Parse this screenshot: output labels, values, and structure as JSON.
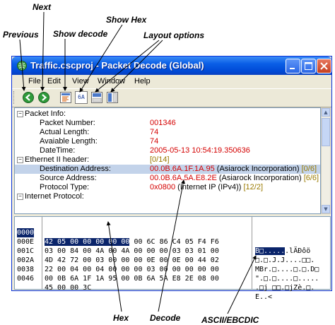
{
  "callouts": {
    "previous": "Previous",
    "next": "Next",
    "show_decode": "Show decode",
    "show_hex": "Show Hex",
    "layout_options": "Layout options",
    "hex": "Hex",
    "decode": "Decode",
    "ascii_ebcdic": "ASCII/EBCDIC"
  },
  "window": {
    "title": "Traffic.cscproj - Packet Decode (Global)",
    "icon": "app-globe-icon"
  },
  "menu": [
    "File",
    "Edit",
    "View",
    "Window",
    "Help"
  ],
  "toolbar": {
    "icons": [
      "previous-icon",
      "next-icon",
      "show-decode-icon",
      "show-hex-icon",
      "layout-options-icon-1",
      "layout-options-icon-2"
    ],
    "hex_button_text": "6A"
  },
  "tree": [
    {
      "label": "Packet Info:",
      "value": "",
      "value_color": "red"
    },
    {
      "label": "Packet Number:",
      "value": "001346",
      "value_color": "red"
    },
    {
      "label": "Actual Length:",
      "value": "74",
      "value_color": "red"
    },
    {
      "label": "Avaiable Length:",
      "value": "74",
      "value_color": "red"
    },
    {
      "label": "DateTime:",
      "value": "2005-05-13 10:54:19.350636",
      "value_color": "red"
    },
    {
      "label": "Ethernet II header:",
      "value": "[0/14]",
      "value_color": "olive"
    },
    {
      "label": "Destination Address:",
      "value": "00.0B.6A.1F.1A.95",
      "value_extra": " (Asiarock Incorporation) ",
      "value_tag": "[0/6]",
      "selected": true
    },
    {
      "label": "Source Address:",
      "value": "00.0B.6A.5A.E8.2E",
      "value_extra": " (Asiarock Incorporation) ",
      "value_tag": "[6/6]"
    },
    {
      "label": "Protocol Type:",
      "value": "0x0800",
      "value_extra": " (Internet IP (IPv4)) ",
      "value_tag": "[12/2]"
    },
    {
      "label": "Internet Protocol:",
      "value": "",
      "value_color": "red"
    }
  ],
  "hex_rows": [
    {
      "offset": "0000",
      "hex_sel": "42 05 00 00 00 00 00",
      "hex_rest": " 00 6C 86 C4 05 F4 F6",
      "ascii_sel": "B□.....",
      "ascii_rest": ".lÄÐôö"
    },
    {
      "offset": "000E",
      "hex_sel": "",
      "hex_rest": "03 00 84 00 4A 00 4A 00 00 00 03 03 01 00",
      "ascii_sel": "",
      "ascii_rest": "□.□.J.J....□□."
    },
    {
      "offset": "001C",
      "hex_sel": "",
      "hex_rest": "4D 42 72 00 03 00 00 00 0E 00 0E 00 44 02",
      "ascii_sel": "",
      "ascii_rest": "MBr.□....□.□.D□"
    },
    {
      "offset": "002A",
      "hex_sel": "",
      "hex_rest": "22 00 04 00 04 00 00 00 03 00 00 00 00 00",
      "ascii_sel": "",
      "ascii_rest": "\".□.□....□....."
    },
    {
      "offset": "0038",
      "hex_sel": "",
      "hex_rest": "00 0B 6A 1F 1A 95 00 0B 6A 5A E8 2E 08 00",
      "ascii_sel": "",
      "ascii_rest": ".□j □□.□jZè.□."
    },
    {
      "offset": "0046",
      "hex_sel": "",
      "hex_rest": "45 00 00 3C",
      "ascii_sel": "",
      "ascii_rest": "E..<"
    }
  ]
}
